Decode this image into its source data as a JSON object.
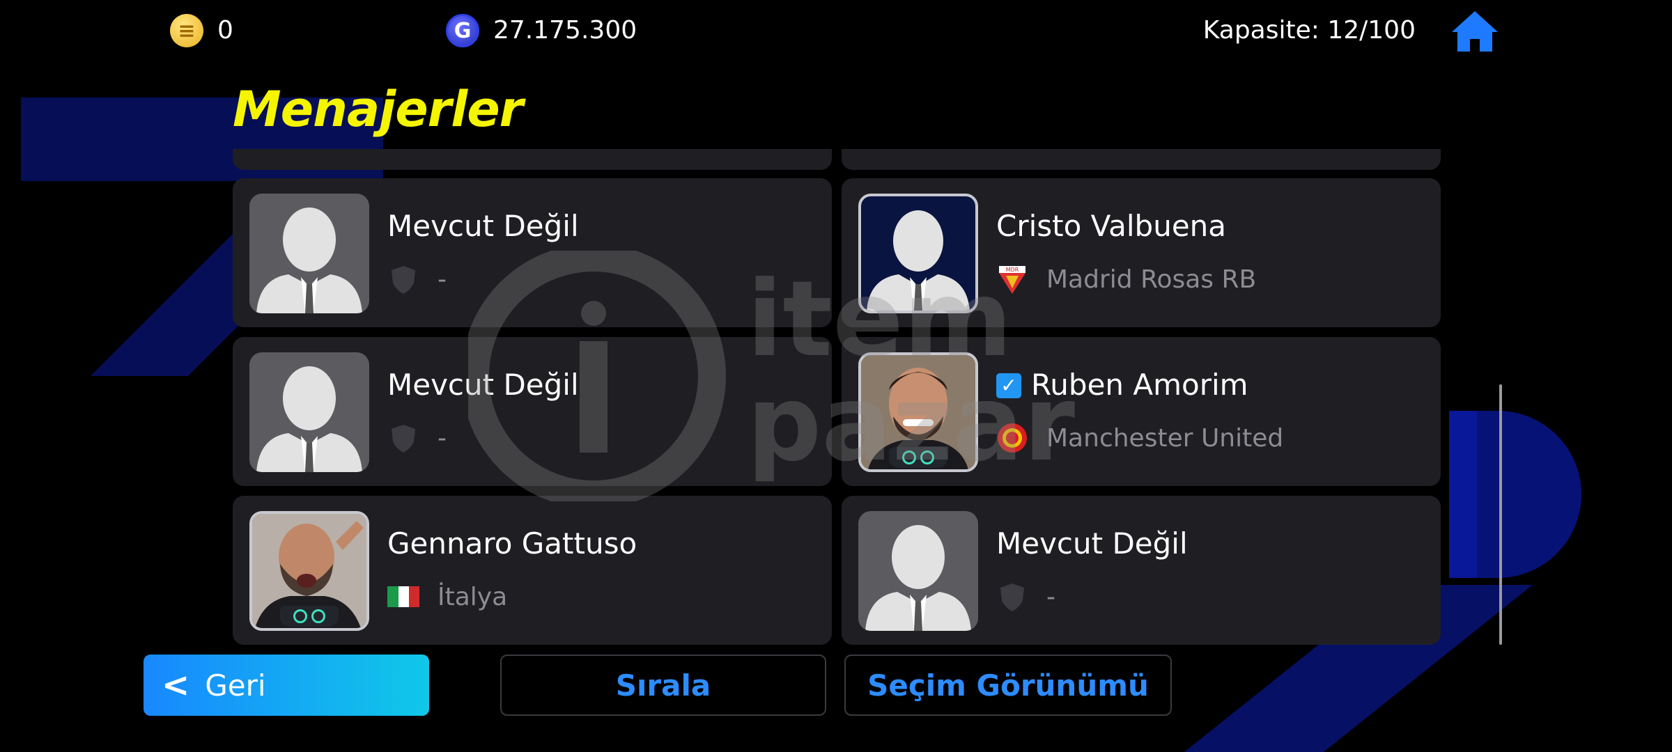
{
  "currency": {
    "coins_icon": "coin-icon",
    "coins": "0",
    "gp_icon": "gp-icon",
    "gp": "27.175.300"
  },
  "capacity": "Kapasite: 12/100",
  "home_icon": "home-icon",
  "title": "Menajerler",
  "managers": [
    {
      "name": "Mevcut Değil",
      "team": "-",
      "team_icon": "shield-icon",
      "portrait": "placeholder"
    },
    {
      "name": "Cristo Valbuena",
      "team": "Madrid Rosas RB",
      "team_icon": "club-crest-icon",
      "portrait": "placeholder-framed"
    },
    {
      "name": "Mevcut Değil",
      "team": "-",
      "team_icon": "shield-icon",
      "portrait": "placeholder"
    },
    {
      "name": "Ruben Amorim",
      "team": "Manchester United",
      "team_icon": "club-crest-icon",
      "portrait": "photo",
      "selected": true
    },
    {
      "name": "Gennaro Gattuso",
      "team": "İtalya",
      "team_icon": "italy-flag-icon",
      "portrait": "photo"
    },
    {
      "name": "Mevcut Değil",
      "team": "-",
      "team_icon": "shield-icon",
      "portrait": "placeholder"
    }
  ],
  "buttons": {
    "back": "Geri",
    "sort": "Sırala",
    "selection_view": "Seçim Görünümü"
  },
  "colors": {
    "title": "#f5f500",
    "accent": "#2d8cff",
    "card": "#1f1f23"
  }
}
